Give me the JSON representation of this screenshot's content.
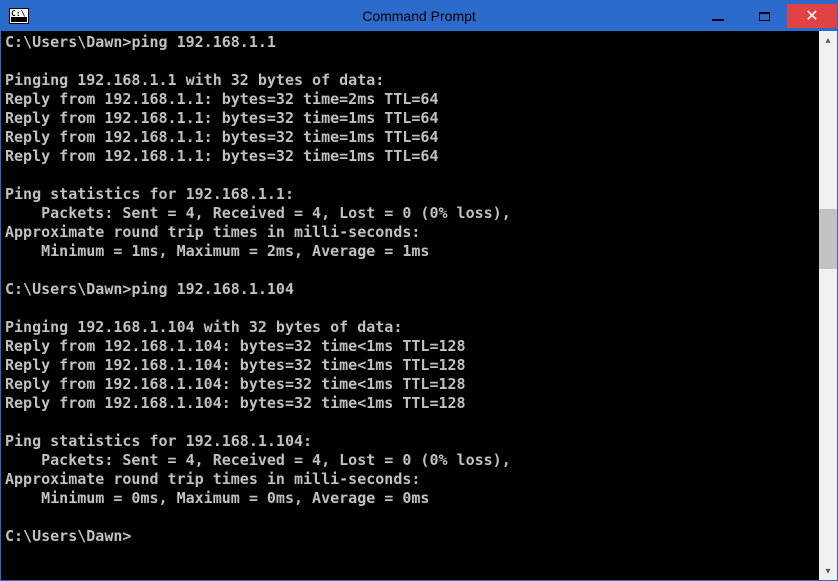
{
  "window": {
    "title": "Command Prompt",
    "icon_label": "C:\\"
  },
  "prompt_path": "C:\\Users\\Dawn>",
  "sessions": [
    {
      "command": "ping 192.168.1.1",
      "header": "Pinging 192.168.1.1 with 32 bytes of data:",
      "replies": [
        "Reply from 192.168.1.1: bytes=32 time=2ms TTL=64",
        "Reply from 192.168.1.1: bytes=32 time=1ms TTL=64",
        "Reply from 192.168.1.1: bytes=32 time=1ms TTL=64",
        "Reply from 192.168.1.1: bytes=32 time=1ms TTL=64"
      ],
      "stats_header": "Ping statistics for 192.168.1.1:",
      "packets_line": "    Packets: Sent = 4, Received = 4, Lost = 0 (0% loss),",
      "rtt_header": "Approximate round trip times in milli-seconds:",
      "rtt_line": "    Minimum = 1ms, Maximum = 2ms, Average = 1ms"
    },
    {
      "command": "ping 192.168.1.104",
      "header": "Pinging 192.168.1.104 with 32 bytes of data:",
      "replies": [
        "Reply from 192.168.1.104: bytes=32 time<1ms TTL=128",
        "Reply from 192.168.1.104: bytes=32 time<1ms TTL=128",
        "Reply from 192.168.1.104: bytes=32 time<1ms TTL=128",
        "Reply from 192.168.1.104: bytes=32 time<1ms TTL=128"
      ],
      "stats_header": "Ping statistics for 192.168.1.104:",
      "packets_line": "    Packets: Sent = 4, Received = 4, Lost = 0 (0% loss),",
      "rtt_header": "Approximate round trip times in milli-seconds:",
      "rtt_line": "    Minimum = 0ms, Maximum = 0ms, Average = 0ms"
    }
  ]
}
